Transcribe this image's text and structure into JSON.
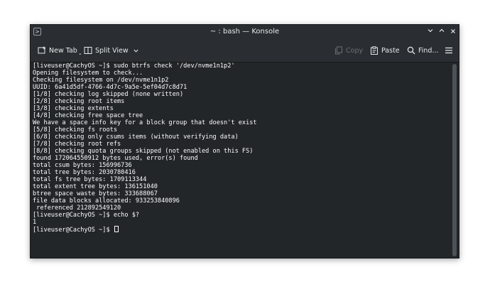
{
  "window": {
    "title": "~ : bash — Konsole",
    "app_icon_glyph": ">"
  },
  "toolbar": {
    "new_tab": "New Tab",
    "split_view": "Split View",
    "copy": "Copy",
    "paste": "Paste",
    "find": "Find..."
  },
  "terminal": {
    "lines": [
      "[liveuser@CachyOS ~]$ sudo btrfs check '/dev/nvme1n1p2'",
      "Opening filesystem to check...",
      "Checking filesystem on /dev/nvme1n1p2",
      "UUID: 6a41d5df-4766-4d7c-9a5e-5ef04d7c8d71",
      "[1/8] checking log skipped (none written)",
      "[2/8] checking root items",
      "[3/8] checking extents",
      "[4/8] checking free space tree",
      "We have a space info key for a block group that doesn't exist",
      "[5/8] checking fs roots",
      "[6/8] checking only csums items (without verifying data)",
      "[7/8] checking root refs",
      "[8/8] checking quota groups skipped (not enabled on this FS)",
      "found 172064550912 bytes used, error(s) found",
      "total csum bytes: 156996736",
      "total tree bytes: 2030780416",
      "total fs tree bytes: 1709113344",
      "total extent tree bytes: 136151040",
      "btree space waste bytes: 333688067",
      "file data blocks allocated: 933253840896",
      " referenced 212892549120",
      "[liveuser@CachyOS ~]$ echo $?",
      "1"
    ],
    "prompt": "[liveuser@CachyOS ~]$ "
  },
  "colors": {
    "background": "#232629",
    "titlebar": "#2a2e32",
    "text": "#fcfcfc",
    "disabled": "#6b7075"
  }
}
